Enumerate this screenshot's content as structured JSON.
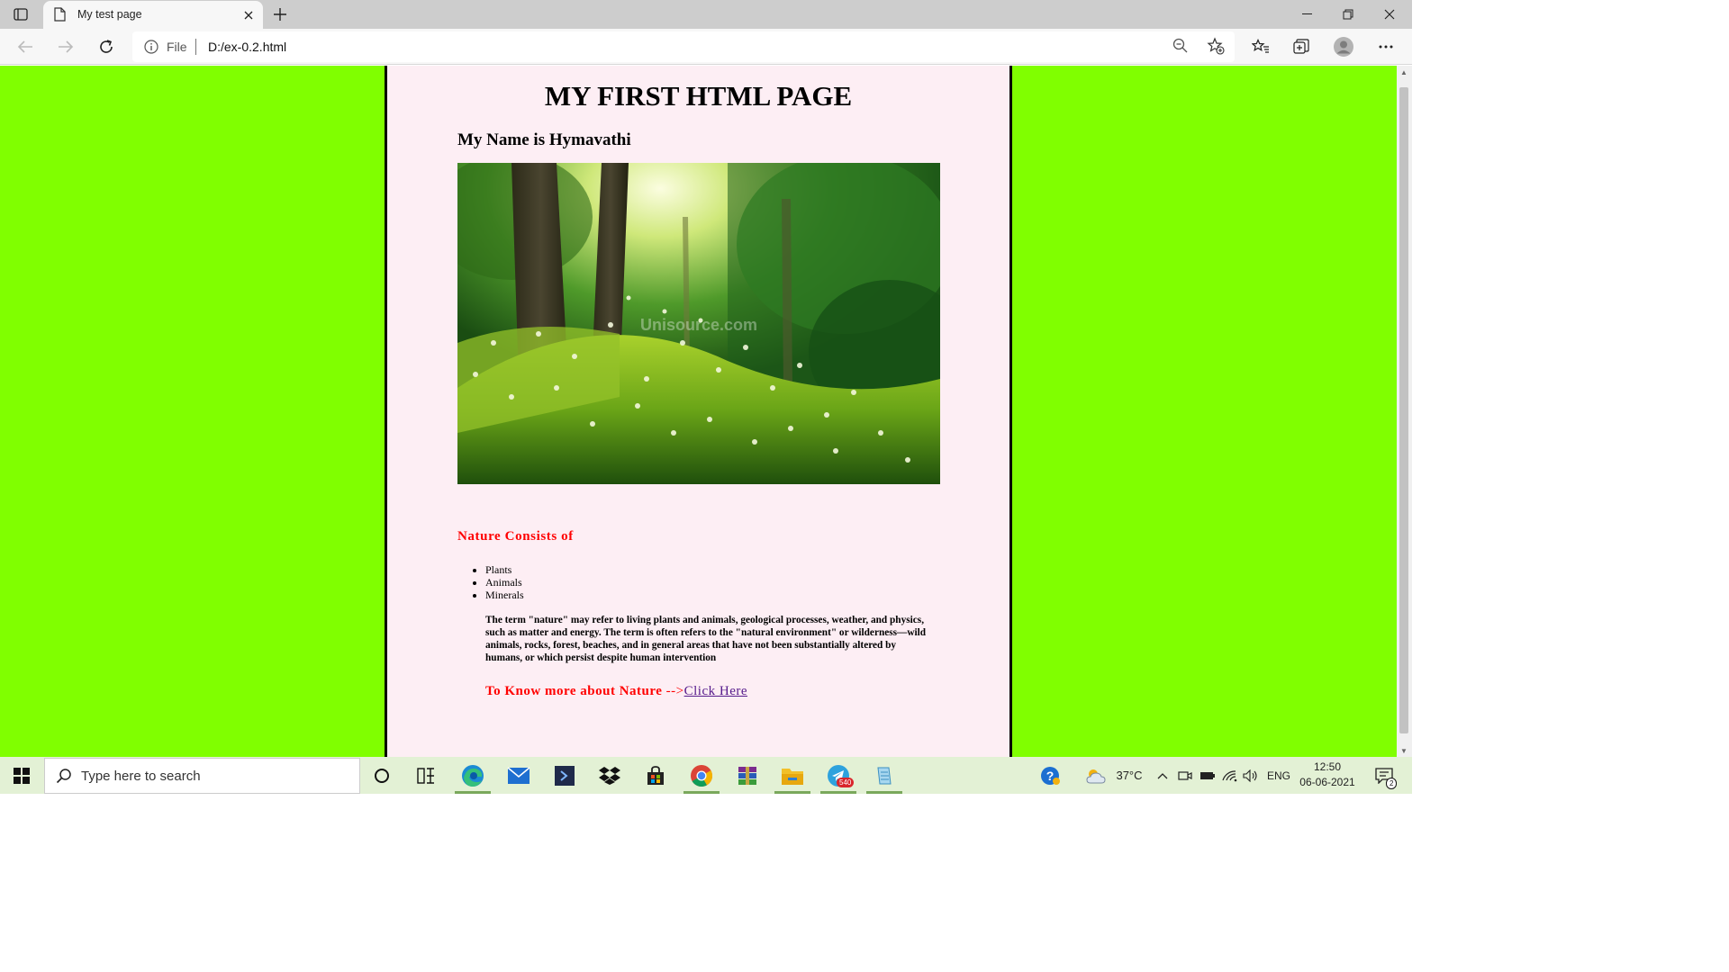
{
  "browser": {
    "tab_title": "My test page",
    "address_scheme": "File",
    "address_url": "D:/ex-0.2.html"
  },
  "page": {
    "heading": "MY FIRST HTML PAGE",
    "name_heading": "My Name is Hymavathi",
    "image_watermark": "Unisource.com",
    "nature_title": "Nature Consists of",
    "nature_items": [
      "Plants",
      "Animals",
      "Minerals"
    ],
    "description": "The term \"nature\" may refer to living plants and animals, geological processes, weather, and physics, such as matter and energy. The term is often refers to the \"natural environment\" or wilderness—wild animals, rocks, forest, beaches, and in general areas that have not been substantially altered by humans, or which persist despite human intervention",
    "more_label": "To Know more about Nature",
    "more_arrow": "-->",
    "more_link": "Click Here"
  },
  "colors": {
    "page_background": "#80ff00",
    "content_background": "#fdeef4",
    "heading_accent": "#ff0000",
    "link": "#551a8b"
  },
  "taskbar": {
    "search_placeholder": "Type here to search",
    "weather": "37°C",
    "language": "ENG",
    "time": "12:50",
    "date": "06-06-2021",
    "telegram_badge": "540",
    "notification_count": "2",
    "apps": [
      "cortana-icon",
      "task-view-icon",
      "edge-icon",
      "mail-icon",
      "powershell-icon",
      "dropbox-icon",
      "store-icon",
      "chrome-icon",
      "winrar-icon",
      "file-explorer-icon",
      "telegram-icon",
      "notepad-icon"
    ]
  }
}
